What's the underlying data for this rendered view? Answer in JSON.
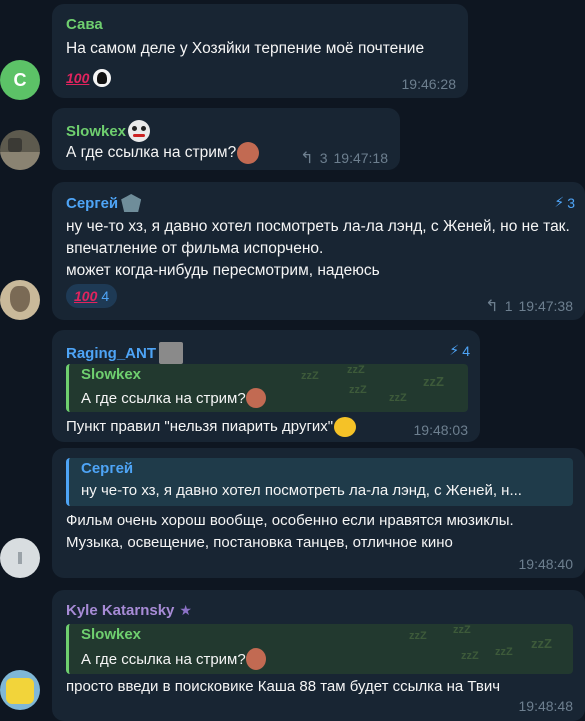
{
  "messages": [
    {
      "sender": "Сава",
      "sender_color": "#6fcf6f",
      "avatar_letter": "С",
      "text": "На самом деле у Хозяйки терпение моё почтение",
      "reactions": "",
      "time": "19:46:28"
    },
    {
      "sender": "Slowkex",
      "sender_color": "#6fcf6f",
      "text": "А где ссылка на стрим?",
      "replies": "3",
      "time": "19:47:18"
    },
    {
      "sender": "Сергей",
      "sender_color": "#4ea4f6",
      "boosts": "3",
      "text": "ну че-то хз, я давно хотел посмотреть ла-ла лэнд, с Женей, но не так. впечатление от фильма испорчено.\nможет когда-нибудь пересмотрим, надеюсь",
      "reaction_count": "4",
      "replies": "1",
      "time": "19:47:38"
    },
    {
      "sender": "Raging_ANT",
      "sender_color": "#4ea4f6",
      "boosts": "4",
      "quote_sender": "Slowkex",
      "quote_text": "А где ссылка на стрим?",
      "text": "Пункт правил \"нельзя пиарить других\"",
      "time": "19:48:03"
    },
    {
      "quote_sender": "Сергей",
      "quote_text": "ну че-то хз, я давно хотел посмотреть ла-ла лэнд, с Женей, н...",
      "text": "Фильм очень хорош вообще, особенно если нравятся мюзиклы.\nМузыка, освещение, постановка танцев, отличное кино",
      "time": "19:48:40"
    },
    {
      "sender": "Kyle Katarnsky",
      "sender_color": "#a78bd6",
      "quote_sender": "Slowkex",
      "quote_text": "А где ссылка на стрим?",
      "text": "просто введи в поисковике Каша 88 там будет ссылка на Твич",
      "time": "19:48:48"
    }
  ],
  "zzz_label": "zzZ"
}
